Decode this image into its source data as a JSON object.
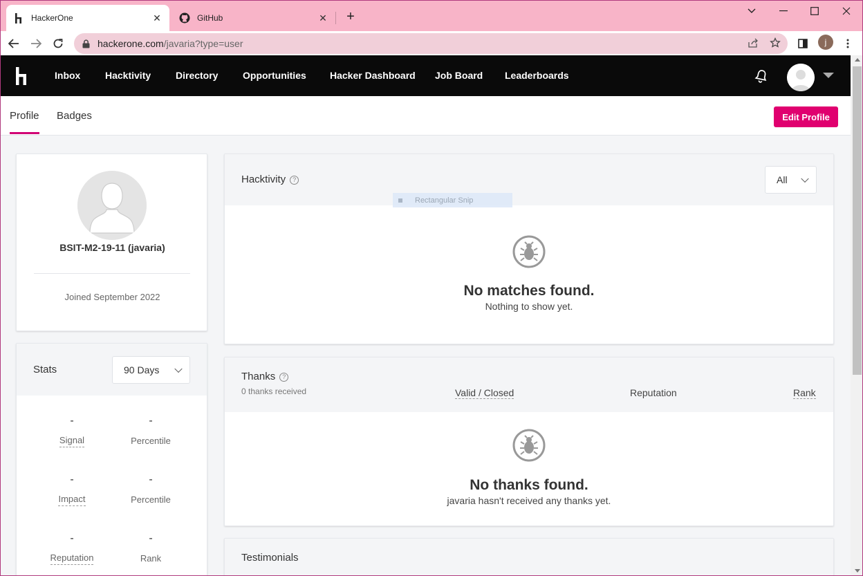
{
  "browser": {
    "tabs": [
      {
        "title": "HackerOne",
        "icon": "hackerone-icon"
      },
      {
        "title": "GitHub",
        "icon": "github-icon"
      }
    ],
    "url_host": "hackerone.com",
    "url_path": "/javaria?type=user",
    "profile_initial": "j"
  },
  "nav": {
    "links": [
      "Inbox",
      "Hacktivity",
      "Directory",
      "Opportunities",
      "Hacker Dashboard",
      "Job Board",
      "Leaderboards"
    ]
  },
  "subtabs": {
    "profile": "Profile",
    "badges": "Badges",
    "edit": "Edit Profile"
  },
  "profile": {
    "name": "BSIT-M2-19-11 (javaria)",
    "joined": "Joined September 2022"
  },
  "stats": {
    "title": "Stats",
    "period": "90 Days",
    "items": [
      {
        "value": "-",
        "label": "Signal",
        "underlined": true
      },
      {
        "value": "-",
        "label": "Percentile",
        "underlined": false
      },
      {
        "value": "-",
        "label": "Impact",
        "underlined": true
      },
      {
        "value": "-",
        "label": "Percentile",
        "underlined": false
      },
      {
        "value": "-",
        "label": "Reputation",
        "underlined": true
      },
      {
        "value": "-",
        "label": "Rank",
        "underlined": false
      }
    ]
  },
  "hacktivity": {
    "title": "Hacktivity",
    "help": "?",
    "filter": "All",
    "empty_title": "No matches found.",
    "empty_sub": "Nothing to show yet."
  },
  "snip": {
    "label": "Rectangular Snip"
  },
  "thanks": {
    "title": "Thanks",
    "help": "?",
    "sub": "0 thanks received",
    "col_valid": "Valid / Closed",
    "col_rep": "Reputation",
    "col_rank": "Rank",
    "empty_title": "No thanks found.",
    "empty_sub": "javaria hasn't received any thanks yet."
  },
  "testimonials": {
    "title": "Testimonials"
  },
  "colors": {
    "accent": "#e0006f",
    "nav_bg": "#0a0a0a",
    "tabstrip": "#f8b4c8"
  }
}
